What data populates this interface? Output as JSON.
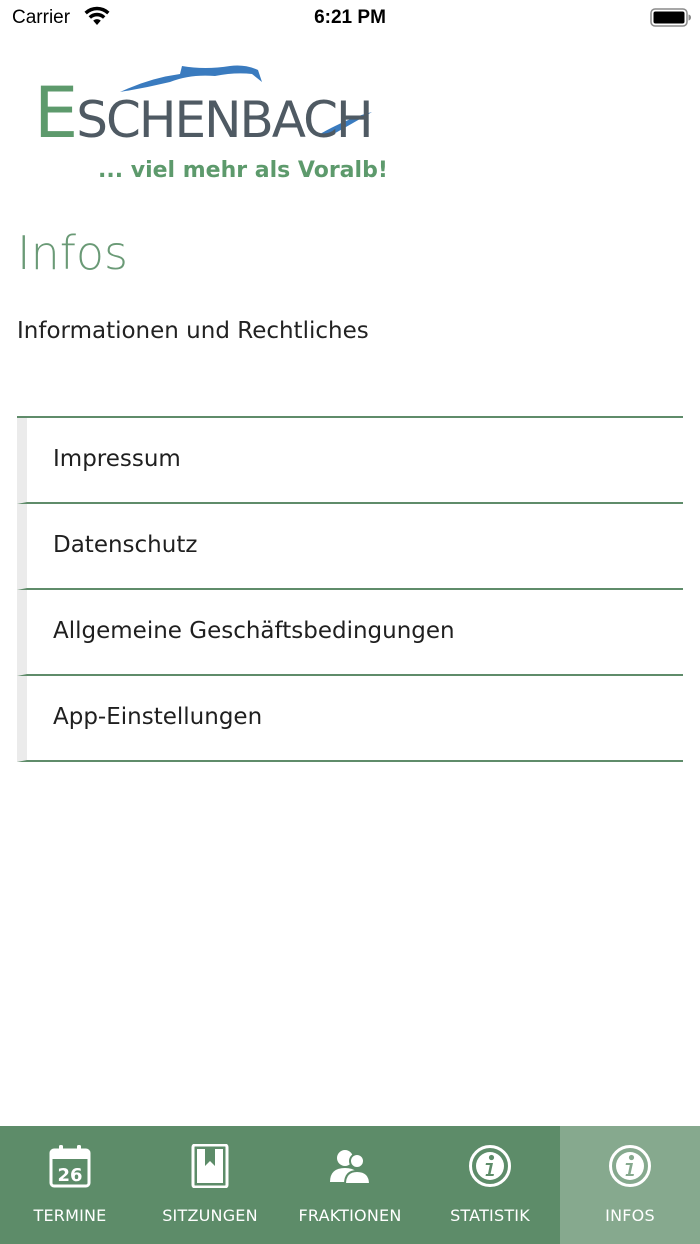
{
  "status_bar": {
    "carrier": "Carrier",
    "time": "6:21 PM",
    "wifi_icon": "wifi-icon",
    "battery_icon": "battery-icon"
  },
  "logo": {
    "letter_first": "E",
    "letter_rest": "SCHENBACH",
    "slogan": "... viel mehr als Voralb!",
    "colors": {
      "green": "#5d9a6c",
      "gray": "#4f5a63",
      "blue": "#3a7bbf"
    }
  },
  "page": {
    "title": "Infos",
    "subtitle": "Informationen und Rechtliches"
  },
  "menu": {
    "items": [
      {
        "label": "Impressum"
      },
      {
        "label": "Datenschutz"
      },
      {
        "label": "Allgemeine Geschäftsbedingungen"
      },
      {
        "label": "App-Einstellungen"
      }
    ]
  },
  "tab_bar": {
    "tabs": [
      {
        "label": "TERMINE",
        "icon": "calendar-icon",
        "calendar_day": "26",
        "active": false
      },
      {
        "label": "SITZUNGEN",
        "icon": "book-icon",
        "active": false
      },
      {
        "label": "FRAKTIONEN",
        "icon": "users-icon",
        "active": false
      },
      {
        "label": "STATISTIK",
        "icon": "info-icon",
        "active": false
      },
      {
        "label": "INFOS",
        "icon": "info-icon",
        "active": true
      }
    ]
  },
  "colors": {
    "accent": "#5d8c69",
    "active_tab": "#86a98e",
    "title": "#6a9a76",
    "divider": "#5f8c6a"
  }
}
